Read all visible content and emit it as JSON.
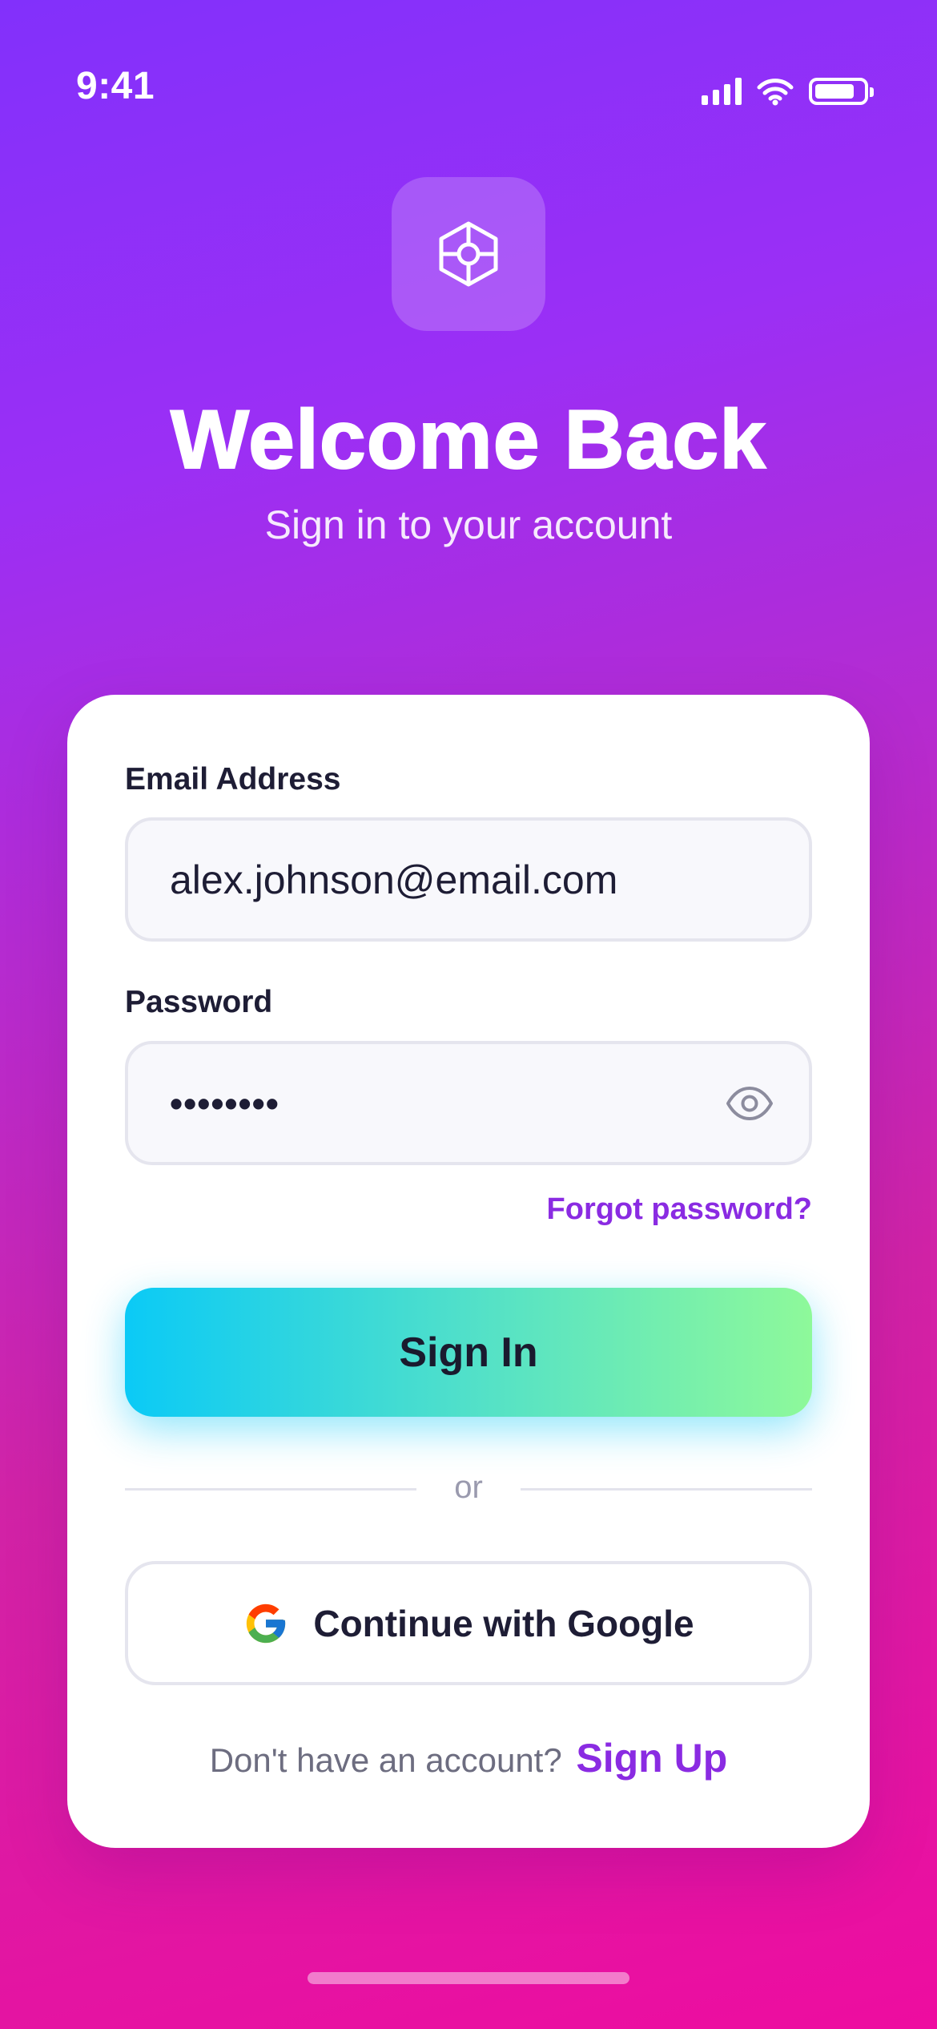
{
  "status_bar": {
    "time": "9:41",
    "icons": [
      "signal-icon",
      "wifi-icon",
      "battery-icon"
    ]
  },
  "header": {
    "logo_icon": "hexagon-crosshair-icon",
    "title": "Welcome Back",
    "subtitle": "Sign in to your account"
  },
  "form": {
    "email": {
      "label": "Email Address",
      "value": "alex.johnson@email.com"
    },
    "password": {
      "label": "Password",
      "masked_value": "••••••••",
      "toggle_icon": "eye-icon"
    },
    "forgot_password_label": "Forgot password?",
    "sign_in_label": "Sign In",
    "divider_text": "or",
    "google_button_label": "Continue with Google",
    "signup_prompt": "Don't have an account?",
    "signup_link_label": "Sign Up"
  },
  "colors": {
    "background_top": "#8230fb",
    "background_bottom": "#ee0ca0",
    "accent": "#8a2be2",
    "button_gradient_start": "#0bcaf6",
    "button_gradient_end": "#8ef99a"
  }
}
